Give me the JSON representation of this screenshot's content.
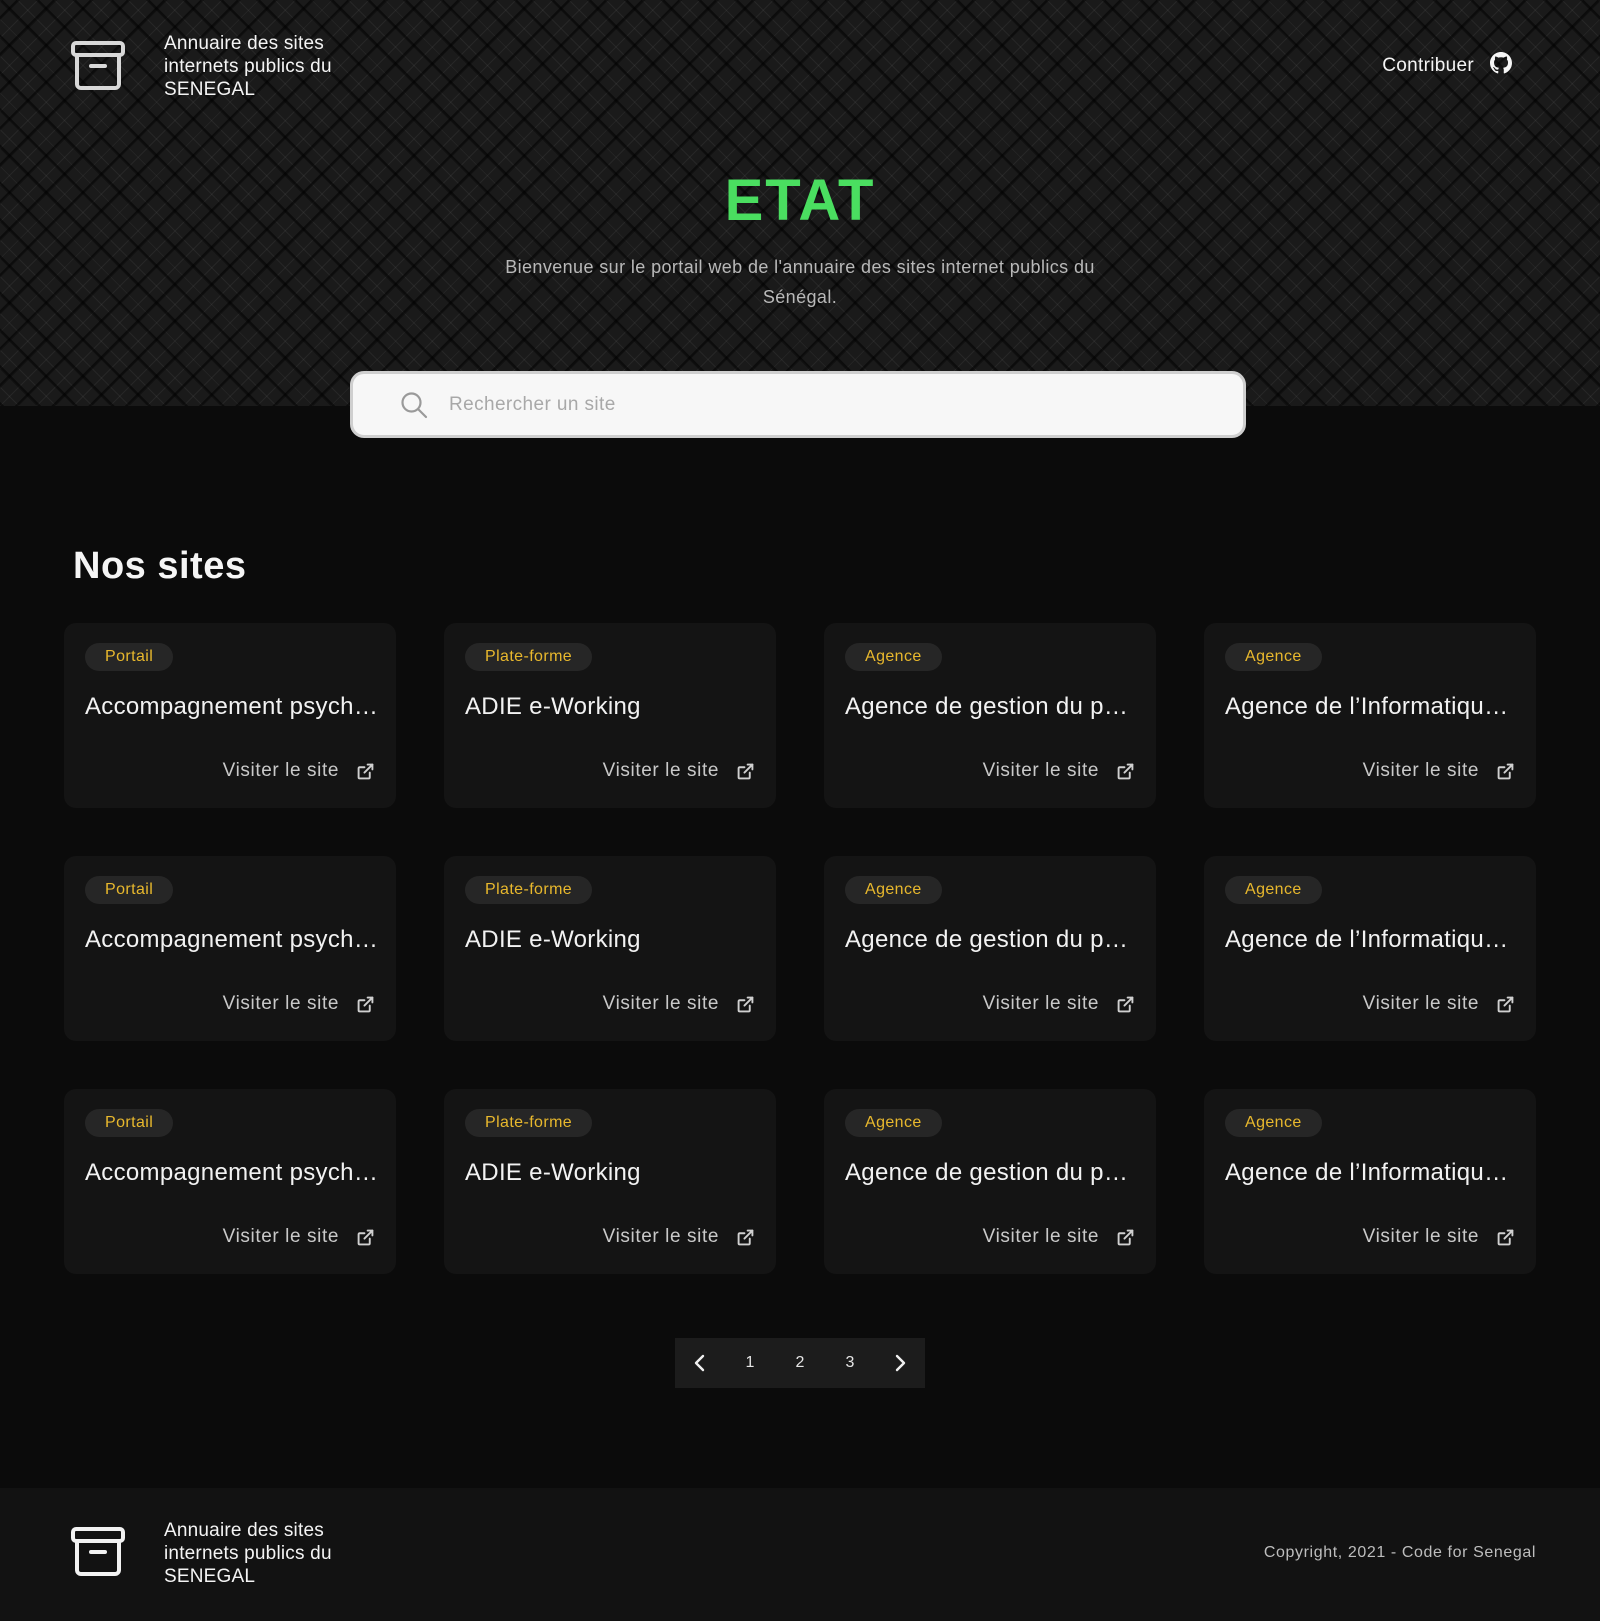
{
  "header": {
    "title": "Annuaire des sites\ninternets publics du\nSENEGAL",
    "contribute_label": "Contribuer",
    "logo_icon": "archive-box-icon",
    "contribute_icon": "github-icon"
  },
  "hero": {
    "title": "ETAT",
    "title_color": "#4ade60",
    "subtitle": "Bienvenue sur le portail web de l'annuaire des sites internet publics du Sénégal."
  },
  "search": {
    "placeholder": "Rechercher un site",
    "value": "",
    "icon": "search-icon"
  },
  "sites": {
    "title": "Nos sites",
    "tag_color": "#e8b82d",
    "visit_icon": "external-link-icon",
    "cards": [
      {
        "tag": "Portail",
        "title": "Accompagnement psychologique",
        "visit_label": "Visiter le site"
      },
      {
        "tag": "Plate-forme",
        "title": "ADIE e-Working",
        "visit_label": "Visiter le site"
      },
      {
        "tag": "Agence",
        "title": "Agence de gestion du patrimoine",
        "visit_label": "Visiter le site"
      },
      {
        "tag": "Agence",
        "title": "Agence de l’Informatique de l’Etat",
        "visit_label": "Visiter le site"
      },
      {
        "tag": "Portail",
        "title": "Accompagnement psychologique",
        "visit_label": "Visiter le site"
      },
      {
        "tag": "Plate-forme",
        "title": "ADIE e-Working",
        "visit_label": "Visiter le site"
      },
      {
        "tag": "Agence",
        "title": "Agence de gestion du patrimoine",
        "visit_label": "Visiter le site"
      },
      {
        "tag": "Agence",
        "title": "Agence de l’Informatique de l’Etat",
        "visit_label": "Visiter le site"
      },
      {
        "tag": "Portail",
        "title": "Accompagnement psychologique",
        "visit_label": "Visiter le site"
      },
      {
        "tag": "Plate-forme",
        "title": "ADIE e-Working",
        "visit_label": "Visiter le site"
      },
      {
        "tag": "Agence",
        "title": "Agence de gestion du patrimoine",
        "visit_label": "Visiter le site"
      },
      {
        "tag": "Agence",
        "title": "Agence de l’Informatique de l’Etat",
        "visit_label": "Visiter le site"
      }
    ]
  },
  "pagination": {
    "pages": [
      "1",
      "2",
      "3"
    ],
    "prev_icon": "chevron-left-icon",
    "next_icon": "chevron-right-icon"
  },
  "footer": {
    "title": "Annuaire des sites\ninternets publics du\nSENEGAL",
    "copyright": "Copyright, 2021 - Code for Senegal"
  }
}
